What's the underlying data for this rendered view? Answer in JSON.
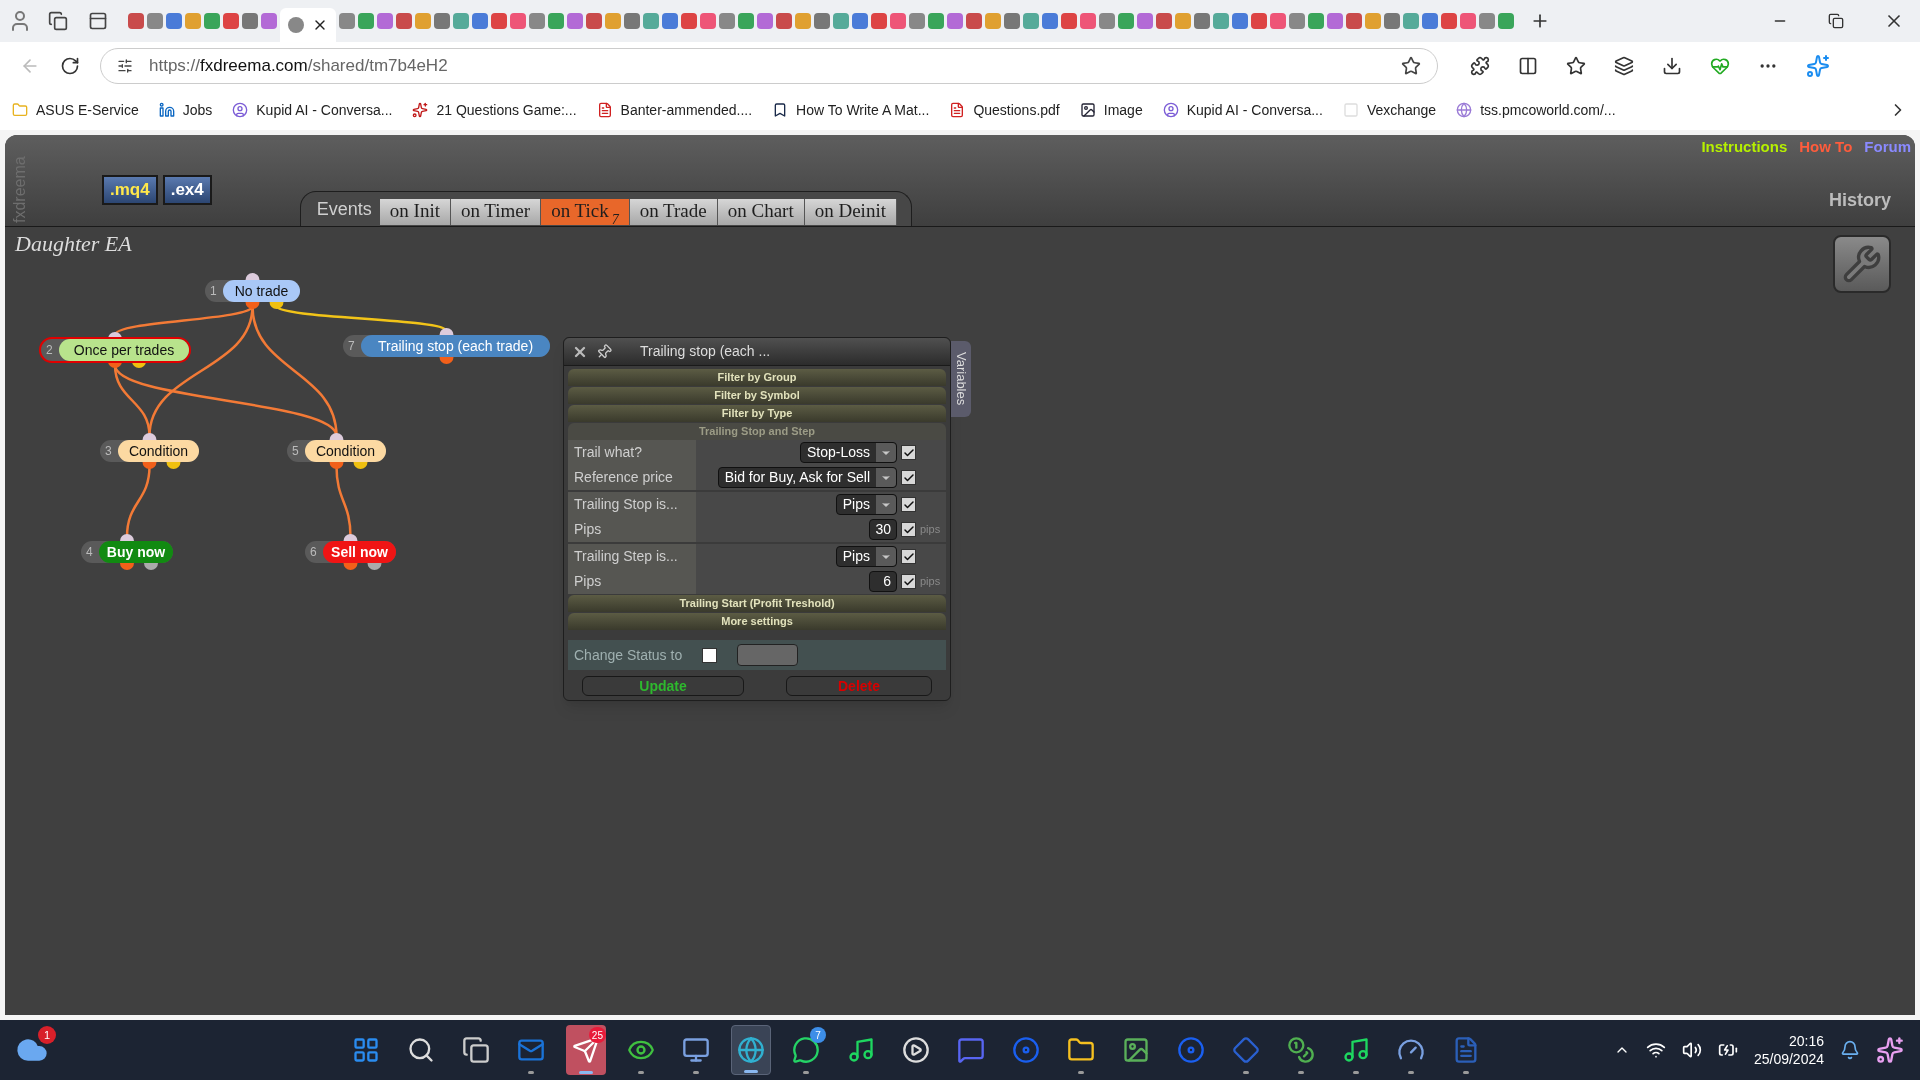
{
  "browser": {
    "address": {
      "scheme": "https://",
      "host": "fxdreema.com",
      "path": "/shared/tm7b4eH2"
    },
    "bookmarks": [
      {
        "label": "ASUS E-Service"
      },
      {
        "label": "Jobs"
      },
      {
        "label": "Kupid AI - Conversa..."
      },
      {
        "label": "21 Questions Game:..."
      },
      {
        "label": "Banter-ammended...."
      },
      {
        "label": "How To Write A Mat..."
      },
      {
        "label": "Questions.pdf"
      },
      {
        "label": "Image"
      },
      {
        "label": "Kupid AI - Conversa..."
      },
      {
        "label": "Vexchange"
      },
      {
        "label": "tss.pmcoworld.com/..."
      }
    ]
  },
  "app": {
    "side_label": "fxdreema",
    "export_buttons": [
      {
        "label": ".mq4",
        "kind": "mq4"
      },
      {
        "label": ".ex4",
        "kind": "ex4"
      }
    ],
    "events_label": "Events",
    "tabs": [
      {
        "label": "on Init",
        "selected": false
      },
      {
        "label": "on Timer",
        "selected": false
      },
      {
        "label": "on Tick",
        "badge": "7",
        "selected": true
      },
      {
        "label": "on Trade",
        "selected": false
      },
      {
        "label": "on Chart",
        "selected": false
      },
      {
        "label": "on Deinit",
        "selected": false
      }
    ],
    "links": [
      {
        "label": "Instructions",
        "color": "#b6f000"
      },
      {
        "label": "How To",
        "color": "#ff5c3c"
      },
      {
        "label": "Forum",
        "color": "#8a8aff"
      }
    ],
    "history_label": "History",
    "project_name": "Daughter EA",
    "nodes": [
      {
        "number": "1",
        "label": "No trade",
        "color": "#a9c8f7",
        "kind": "block",
        "selected": false
      },
      {
        "number": "2",
        "label": "Once per trades",
        "color": "#b8e38c",
        "kind": "block",
        "selected": true
      },
      {
        "number": "7",
        "label": "Trailing stop (each trade)",
        "color": "#4a86c2",
        "kind": "single",
        "selected": false
      },
      {
        "number": "3",
        "label": "Condition",
        "color": "#fcd9a2",
        "kind": "block",
        "selected": false
      },
      {
        "number": "5",
        "label": "Condition",
        "color": "#fcd9a2",
        "kind": "block",
        "selected": false
      },
      {
        "number": "4",
        "label": "Buy now",
        "color": "#118a11",
        "kind": "action",
        "selected": false
      },
      {
        "number": "6",
        "label": "Sell now",
        "color": "#f01414",
        "kind": "action",
        "selected": false
      }
    ],
    "dialog": {
      "title": "Trailing stop (each ...",
      "side_tab": "Variables",
      "sections": [
        {
          "title": "Filter by Group",
          "expanded": false
        },
        {
          "title": "Filter by Symbol",
          "expanded": false
        },
        {
          "title": "Filter by Type",
          "expanded": false
        },
        {
          "title": "Trailing Stop and Step",
          "expanded": true,
          "groups": [
            [
              {
                "label": "Trail what?",
                "kind": "select",
                "value": "Stop-Loss",
                "checked": true
              },
              {
                "label": "Reference price",
                "kind": "select",
                "value": "Bid for Buy, Ask for Sell",
                "checked": true
              }
            ],
            [
              {
                "label": "Trailing Stop is...",
                "kind": "select",
                "value": "Pips",
                "checked": true
              },
              {
                "label": "Pips",
                "kind": "number",
                "value": "30",
                "unit": "pips",
                "checked": true
              }
            ],
            [
              {
                "label": "Trailing Step is...",
                "kind": "select",
                "value": "Pips",
                "checked": true
              },
              {
                "label": "Pips",
                "kind": "number",
                "value": "6",
                "unit": "pips",
                "checked": true
              }
            ]
          ]
        },
        {
          "title": "Trailing Start (Profit Treshold)",
          "expanded": false
        },
        {
          "title": "More settings",
          "expanded": false
        }
      ],
      "status": {
        "label": "Change Status to",
        "checked": false
      },
      "buttons": [
        {
          "label": "Update",
          "kind": "update"
        },
        {
          "label": "Delete",
          "kind": "delete"
        }
      ]
    }
  },
  "taskbar": {
    "widget_badge": "1",
    "apps": [
      {
        "running": false,
        "selected": false
      },
      {
        "running": false,
        "selected": false
      },
      {
        "running": false,
        "selected": false
      },
      {
        "running": true,
        "selected": false
      },
      {
        "running": true,
        "selected": false,
        "attention": true,
        "badge": "25",
        "color": "#e81b3a"
      },
      {
        "running": true,
        "selected": false
      },
      {
        "running": true,
        "selected": false
      },
      {
        "running": true,
        "selected": true
      },
      {
        "running": true,
        "selected": false,
        "badge": "7",
        "color": "#3d8ee8"
      },
      {
        "running": false,
        "selected": false
      },
      {
        "running": false,
        "selected": false
      },
      {
        "running": false,
        "selected": false
      },
      {
        "running": false,
        "selected": false
      },
      {
        "running": true,
        "selected": false
      },
      {
        "running": false,
        "selected": false
      },
      {
        "running": false,
        "selected": false
      },
      {
        "running": true,
        "selected": false
      },
      {
        "running": true,
        "selected": false
      },
      {
        "running": true,
        "selected": false
      },
      {
        "running": true,
        "selected": false
      },
      {
        "running": true,
        "selected": false
      }
    ],
    "time": "20:16",
    "date": "25/09/2024"
  }
}
